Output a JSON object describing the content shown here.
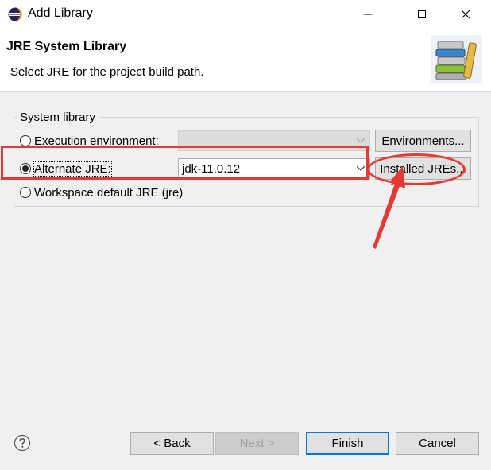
{
  "window": {
    "title": "Add Library",
    "minimize_icon": "minimize-icon",
    "maximize_icon": "maximize-icon",
    "close_icon": "close-icon"
  },
  "header": {
    "title": "JRE System Library",
    "description": "Select JRE for the project build path.",
    "image_icon": "library-books-icon"
  },
  "system_library": {
    "group_label": "System library",
    "execution_environment": {
      "label": "Execution environment:",
      "selected": false,
      "value": "",
      "button_label": "Environments..."
    },
    "alternate_jre": {
      "label": "Alternate JRE:",
      "selected": true,
      "value": "jdk-11.0.12",
      "button_label": "Installed JREs..."
    },
    "workspace_default": {
      "label": "Workspace default JRE (jre)",
      "selected": false
    }
  },
  "footer": {
    "help_icon": "help-icon",
    "back_label": "< Back",
    "next_label": "Next >",
    "finish_label": "Finish",
    "cancel_label": "Cancel"
  },
  "annotation": {
    "color": "#e53935"
  }
}
